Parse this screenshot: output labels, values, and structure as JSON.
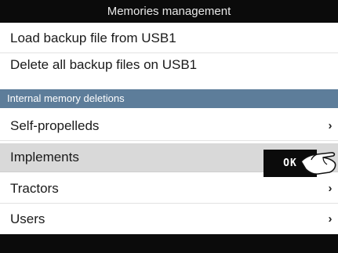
{
  "header": {
    "title": "Memories management"
  },
  "usb_actions": [
    {
      "label": "Load backup file from USB1"
    },
    {
      "label": "Delete all backup files on USB1"
    }
  ],
  "section": {
    "title": "Internal memory deletions"
  },
  "items": [
    {
      "label": "Self-propelleds",
      "chevron": "›"
    },
    {
      "label": "Implements"
    },
    {
      "label": "Tractors",
      "chevron": "›"
    },
    {
      "label": "Users",
      "chevron": "›"
    }
  ],
  "ok_button": {
    "label": "OK"
  },
  "icons": {
    "pointer": "pointing-hand-icon",
    "chevron": "chevron-right-icon"
  }
}
